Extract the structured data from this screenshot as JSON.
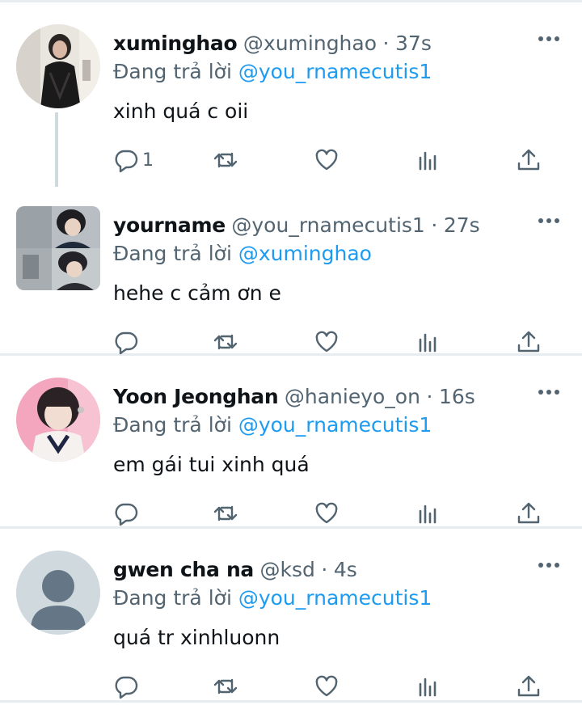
{
  "tweets": [
    {
      "name": "xuminghao",
      "handle": "@xuminghao",
      "dot": "·",
      "time": "37s",
      "replying_prefix": "Đang trả lời",
      "replying_to": "@you_rnamecutis1",
      "text": "xinh quá c oii",
      "reply_count": "1",
      "avatar": "photo"
    },
    {
      "name": "yourname",
      "handle": "@you_rnamecutis1",
      "dot": "·",
      "time": "27s",
      "replying_prefix": "Đang trả lời",
      "replying_to": "@xuminghao",
      "text": "hehe c cảm ơn e",
      "reply_count": "",
      "avatar": "photo-collage"
    },
    {
      "name": "Yoon Jeonghan",
      "handle": "@hanieyo_on",
      "dot": "·",
      "time": "16s",
      "replying_prefix": "Đang trả lời",
      "replying_to": "@you_rnamecutis1",
      "text": "em gái tui xinh quá",
      "reply_count": "",
      "avatar": "photo"
    },
    {
      "name": "gwen cha na",
      "handle": "@ksd",
      "dot": "·",
      "time": "4s",
      "replying_prefix": "Đang trả lời",
      "replying_to": "@you_rnamecutis1",
      "text": "quá tr xinhluonn",
      "reply_count": "",
      "avatar": "default-avatar-icon"
    }
  ],
  "icons": [
    "reply-icon",
    "retweet-icon",
    "like-icon",
    "views-icon",
    "share-icon",
    "more-icon"
  ],
  "colors": {
    "accent": "#1d9bf0",
    "secondary_text": "#536471",
    "divider": "#e6ecf0",
    "default_avatar_bg": "#cfd9de"
  }
}
